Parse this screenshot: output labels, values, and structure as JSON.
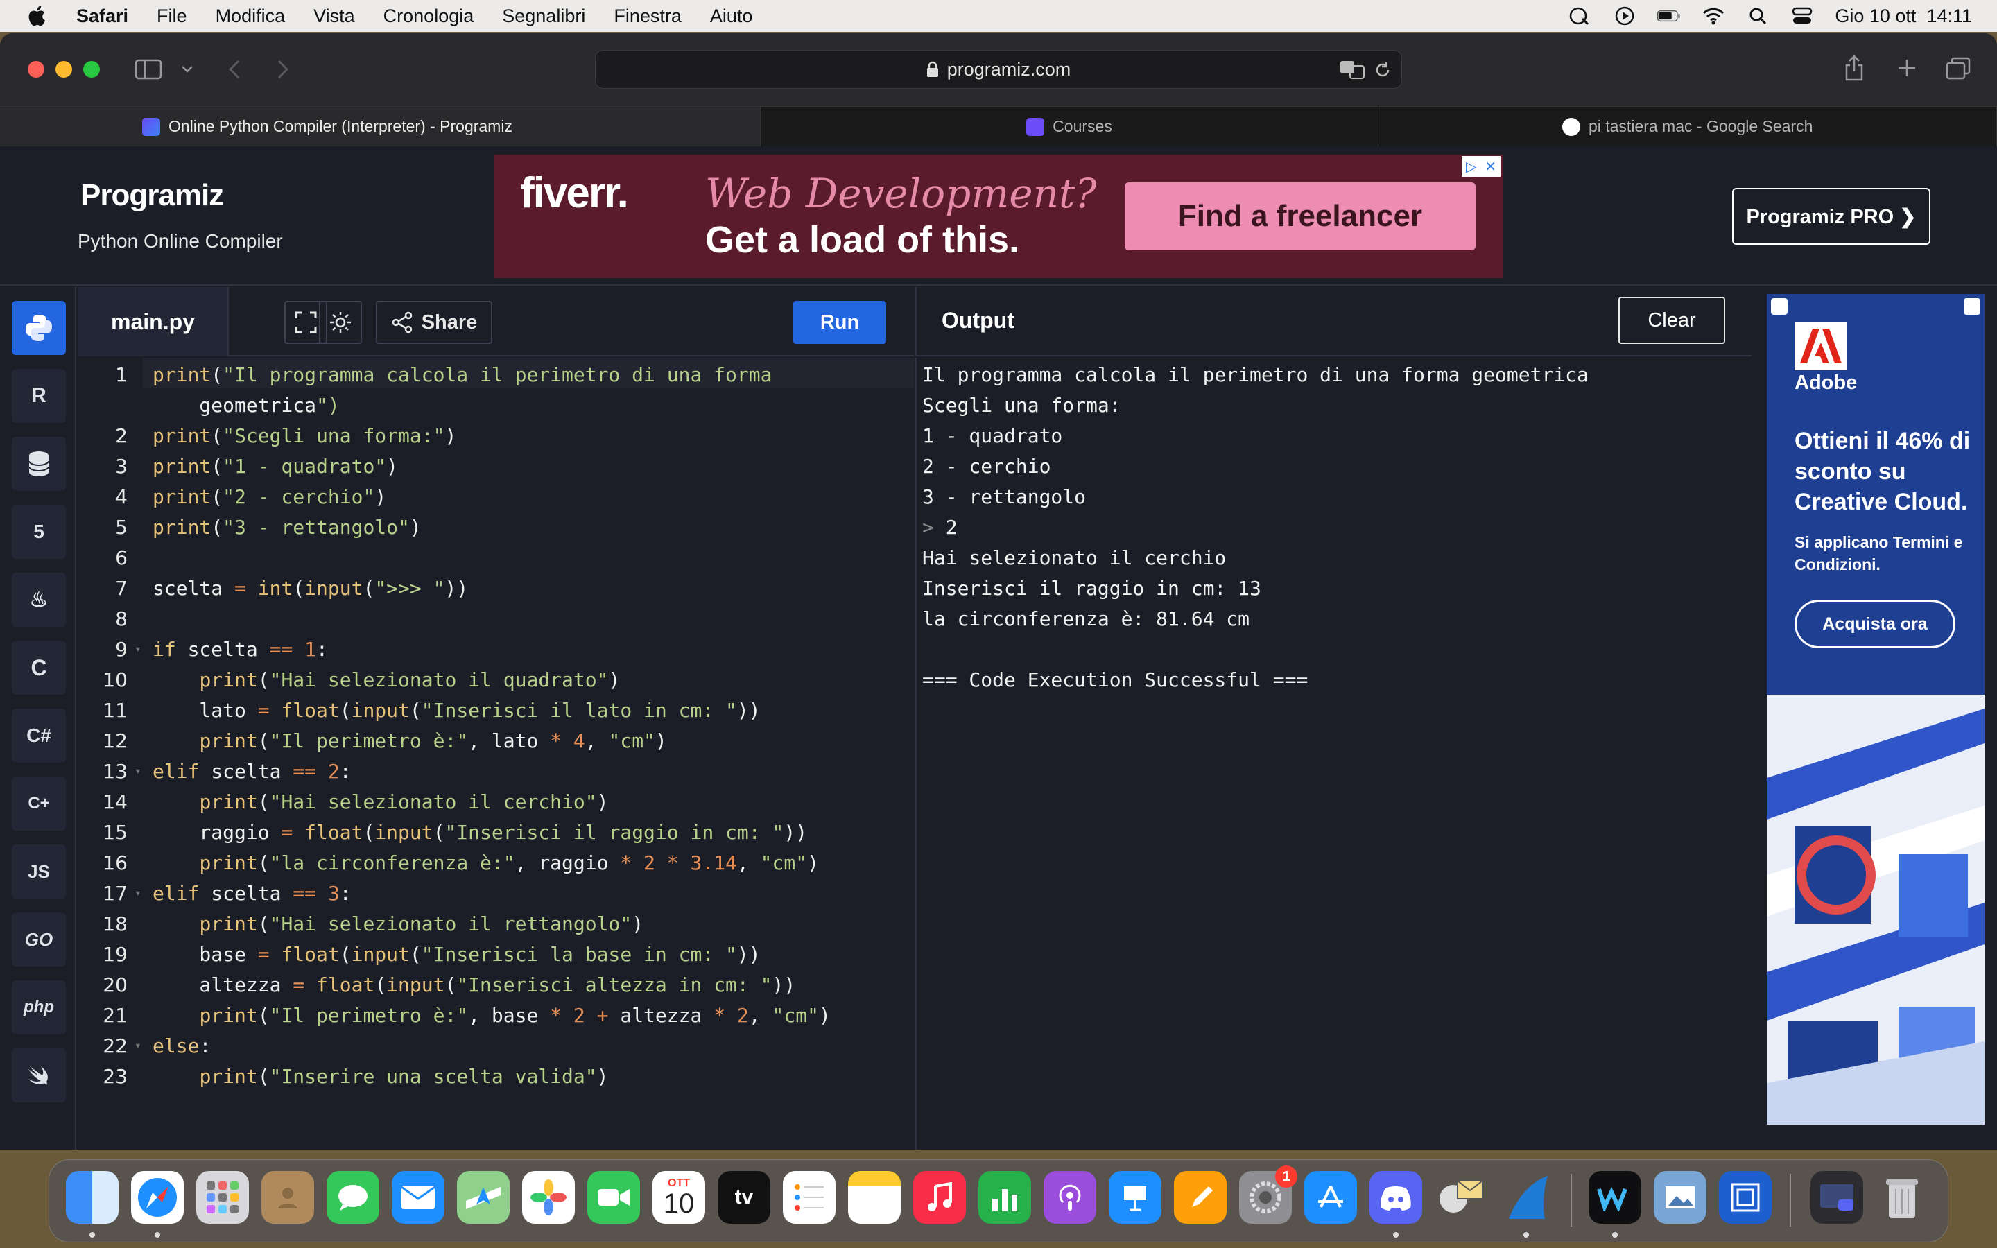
{
  "menubar": {
    "app": "Safari",
    "items": [
      "File",
      "Modifica",
      "Vista",
      "Cronologia",
      "Segnalibri",
      "Finestra",
      "Aiuto"
    ],
    "clock": "Gio 10 ott  14:11"
  },
  "browser": {
    "url": "programiz.com",
    "tabs": [
      {
        "label": "Online Python Compiler (Interpreter) - Programiz",
        "active": true
      },
      {
        "label": "Courses",
        "active": false
      },
      {
        "label": "pi tastiera mac - Google Search",
        "active": false
      }
    ]
  },
  "site": {
    "logo": "Programiz",
    "subtitle": "Python Online Compiler",
    "pro_button": "Programiz PRO ❯",
    "top_ad": {
      "brand": "fiverr.",
      "line1": "Web Development?",
      "line2": "Get a load of this.",
      "cta": "Find a freelancer"
    }
  },
  "languages": [
    "python",
    "r",
    "sql",
    "html",
    "java",
    "c",
    "csharp",
    "cpp",
    "JS",
    "GO",
    "php",
    "swift"
  ],
  "editor": {
    "filename": "main.py",
    "share_label": "Share",
    "run_label": "Run",
    "lines": [
      {
        "n": "1",
        "text": "print(\"Il programma calcola il perimetro di una forma"
      },
      {
        "n": "",
        "text": "    geometrica\")"
      },
      {
        "n": "2",
        "text": "print(\"Scegli una forma:\")"
      },
      {
        "n": "3",
        "text": "print(\"1 - quadrato\")"
      },
      {
        "n": "4",
        "text": "print(\"2 - cerchio\")"
      },
      {
        "n": "5",
        "text": "print(\"3 - rettangolo\")"
      },
      {
        "n": "6",
        "text": ""
      },
      {
        "n": "7",
        "text": "scelta = int(input(\">>> \"))"
      },
      {
        "n": "8",
        "text": ""
      },
      {
        "n": "9",
        "text": "if scelta == 1:"
      },
      {
        "n": "10",
        "text": "    print(\"Hai selezionato il quadrato\")"
      },
      {
        "n": "11",
        "text": "    lato = float(input(\"Inserisci il lato in cm: \"))"
      },
      {
        "n": "12",
        "text": "    print(\"Il perimetro è:\", lato * 4, \"cm\")"
      },
      {
        "n": "13",
        "text": "elif scelta == 2:"
      },
      {
        "n": "14",
        "text": "    print(\"Hai selezionato il cerchio\")"
      },
      {
        "n": "15",
        "text": "    raggio = float(input(\"Inserisci il raggio in cm: \"))"
      },
      {
        "n": "16",
        "text": "    print(\"la circonferenza è:\", raggio * 2 * 3.14, \"cm\")"
      },
      {
        "n": "17",
        "text": "elif scelta == 3:"
      },
      {
        "n": "18",
        "text": "    print(\"Hai selezionato il rettangolo\")"
      },
      {
        "n": "19",
        "text": "    base = float(input(\"Inserisci la base in cm: \"))"
      },
      {
        "n": "20",
        "text": "    altezza = float(input(\"Inserisci altezza in cm: \"))"
      },
      {
        "n": "21",
        "text": "    print(\"Il perimetro è:\", base * 2 + altezza * 2, \"cm\")"
      },
      {
        "n": "22",
        "text": "else:"
      },
      {
        "n": "23",
        "text": "    print(\"Inserire una scelta valida\")"
      }
    ]
  },
  "output": {
    "title": "Output",
    "clear_label": "Clear",
    "lines": [
      "Il programma calcola il perimetro di una forma geometrica",
      "Scegli una forma:",
      "1 - quadrato",
      "2 - cerchio",
      "3 - rettangolo",
      "> 2",
      "Hai selezionato il cerchio",
      "Inserisci il raggio in cm: 13",
      "la circonferenza è: 81.64 cm",
      "",
      "=== Code Execution Successful ==="
    ]
  },
  "side_ad": {
    "brand": "Adobe",
    "headline": "Ottieni il 46% di sconto su Creative Cloud.",
    "subtext": "Si applicano Termini e Condizioni.",
    "cta": "Acquista ora"
  },
  "dock": {
    "calendar_month": "OTT",
    "calendar_day": "10",
    "settings_badge": "1",
    "tv_label": "tv"
  },
  "colors": {
    "accent": "#2466e0",
    "keyword": "#e7c27a",
    "string": "#b8d28c",
    "number": "#e88f55",
    "background": "#1c1e27"
  }
}
